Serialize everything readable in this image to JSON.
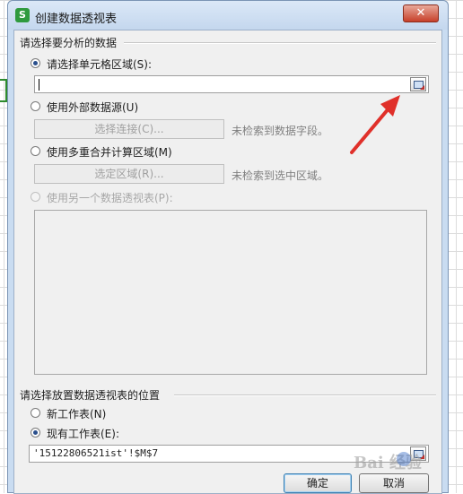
{
  "window": {
    "app_icon_letter": "S",
    "title": "创建数据透视表",
    "close_label": "✕"
  },
  "source_group": {
    "title": "请选择要分析的数据",
    "option_range": {
      "label": "请选择单元格区域(S):",
      "selected": true
    },
    "range_input": {
      "value": ""
    },
    "option_external": {
      "label": "使用外部数据源(U)",
      "selected": false
    },
    "choose_connection": {
      "label": "选择连接(C)...",
      "hint": "未检索到数据字段。"
    },
    "option_multi": {
      "label": "使用多重合并计算区域(M)",
      "selected": false
    },
    "choose_region": {
      "label": "选定区域(R)...",
      "hint": "未检索到选中区域。"
    },
    "option_other_pivot": {
      "label": "使用另一个数据透视表(P):",
      "selected": false
    }
  },
  "dest_group": {
    "title": "请选择放置数据透视表的位置",
    "option_new_sheet": {
      "label": "新工作表(N)",
      "selected": false
    },
    "option_existing": {
      "label": "现有工作表(E):",
      "selected": true
    },
    "location_input": {
      "value": "'15122806521ist'!$M$7"
    }
  },
  "buttons": {
    "ok": "确定",
    "cancel": "取消"
  },
  "watermark": {
    "text": "Bai  经验"
  },
  "colors": {
    "accent": "#2a4f8c",
    "arrow": "#e0302a",
    "close": "#c7402a",
    "excel_green": "#2f9a3e"
  }
}
